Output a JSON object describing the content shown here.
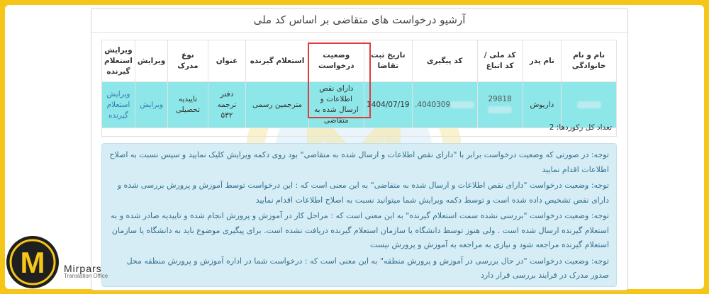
{
  "panel": {
    "title": "آرشیو درخواست های متقاضی بر اساس کد ملی"
  },
  "table": {
    "headers": [
      "نام و نام خانوادگی",
      "نام پدر",
      "کد ملی /کد اتباع",
      "کد پیگیری",
      "تاریخ ثبت تقاضا",
      "وضعیت درخواست",
      "استعلام گیرنده",
      "عنوان",
      "نوع مدرک",
      "ویرایش",
      "ویرایش استعلام گیرنده"
    ],
    "row": {
      "name": "",
      "father": "داریوش",
      "national_code": "29818",
      "tracking_code": "4040309.",
      "date": "1404/07/19",
      "status": "دارای نقص اطلاعات و ارسال شده به متقاضی",
      "inquirer": "مترجمین رسمی",
      "title": "دفتر ترجمه ۵۳۲",
      "doc_type": "تاییدیه تحصیلی",
      "edit": "ویرایش",
      "edit_inquirer": "ویرایش استعلام گیرنده"
    },
    "record_count": "تعداد کل رکوردها: 2"
  },
  "notes": [
    "توجه: در صورتی که وضعیت درخواست برابر با \"دارای نقص اطلاعات و ارسال شده به متقاضی\" بود روی دکمه ویرایش کلیک نمایید و سپس نسبت به اصلاح اطلاعات اقدام نمایید",
    "توجه: وضعیت درخواست \"دارای نقص اطلاعات و ارسال شده به متقاضی\" به این معنی است که : این درخواست توسط آموزش و پرورش بررسی شده و دارای نقص تشخیص داده شده است و توسط دکمه ویرایش شما میتوانید نسبت به اصلاح اطلاعات اقدام نمایید",
    "توجه: وضعیت درخواست \"بررسی نشده سمت استعلام گیرنده\" به این معنی است که : مراحل کار در آموزش و پرورش انجام شده و تاییدیه صادر شده و به استعلام گیرنده ارسال شده است . ولی هنوز توسط دانشگاه یا سازمان استعلام گیرنده دریافت نشده است. برای پیگیری موضوع باید به دانشگاه یا سازمان استعلام گیرنده مراجعه شود و نیازی به مراجعه به آموزش و پرورش نیست",
    "توجه: وضعیت درخواست \"در حال بررسی در آموزش و پرورش منطقه\" به این معنی است که : درخواست شما در اداره آموزش و پرورش منطقه محل صدور مدرک در فرایند بررسی قرار دارد"
  ],
  "brand": {
    "name": "Mirpars",
    "tagline": "Translation Office",
    "logo_letter": "M",
    "accent": "#f5c518"
  }
}
